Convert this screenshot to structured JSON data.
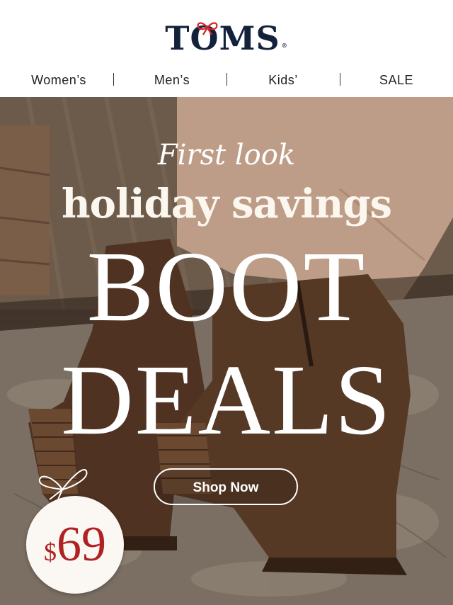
{
  "brand": {
    "logo_text": "TOMS",
    "registered_mark": "®"
  },
  "nav": {
    "items": [
      {
        "label": "Women’s"
      },
      {
        "label": "Men’s"
      },
      {
        "label": "Kids’"
      },
      {
        "label": "SALE"
      }
    ]
  },
  "hero": {
    "script_heading": "First look",
    "heading": "holiday savings",
    "headline_line1": "BOOT",
    "headline_line2": "DEALS",
    "cta_label": "Shop Now",
    "price_badge": {
      "currency": "$",
      "amount": "69"
    }
  },
  "colors": {
    "logo": "#14213b",
    "bow_accent": "#d8232a",
    "price": "#b02121",
    "hero_text": "#ffffff"
  }
}
